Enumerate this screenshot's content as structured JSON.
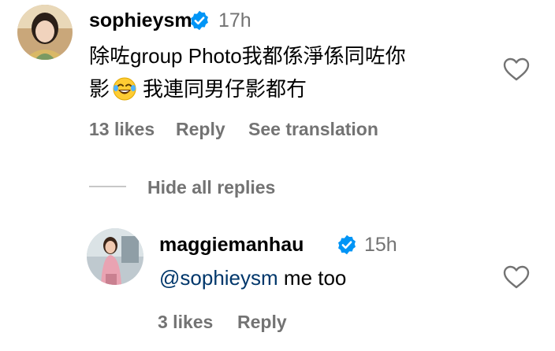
{
  "comment": {
    "username": "sophieysm",
    "time": "17h",
    "text_line1": "除咗group Photo我都係淨係同咗你",
    "text_line2_prefix": "影",
    "text_line2_suffix": "我連同男仔影都冇",
    "emoji": "laughing-with-tears-emoji",
    "likes": "13 likes",
    "reply_label": "Reply",
    "translate_label": "See translation"
  },
  "replies_toggle": {
    "label": "Hide all replies"
  },
  "reply": {
    "username": "maggiemanhau",
    "time": "15h",
    "mention": "@sophieysm",
    "text": "me too",
    "likes": "3 likes",
    "reply_label": "Reply"
  },
  "colors": {
    "secondary_text": "#737373",
    "verified_badge": "#0095f6",
    "mention": "#00376b",
    "divider": "#c7c7c7"
  }
}
